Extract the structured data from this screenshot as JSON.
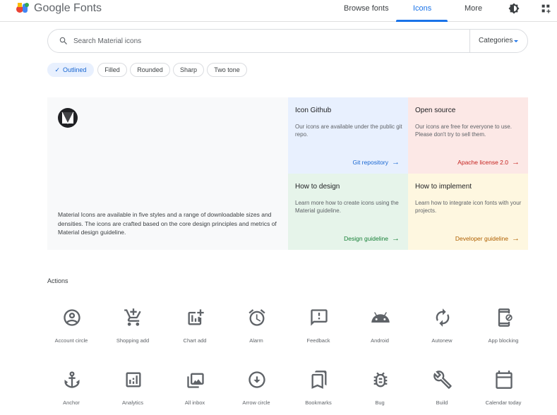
{
  "header": {
    "brand": "Google Fonts",
    "nav": {
      "browse": "Browse fonts",
      "icons": "Icons",
      "more": "More"
    },
    "logo_colors": [
      "#4285f4",
      "#ea4335",
      "#fbbc04",
      "#34a853"
    ],
    "active_color": "#1a73e8"
  },
  "search": {
    "placeholder": "Search Material icons",
    "categories_label": "Categories"
  },
  "styles": {
    "chips": [
      "Outlined",
      "Filled",
      "Rounded",
      "Sharp",
      "Two tone"
    ],
    "selected": "Outlined"
  },
  "intro": {
    "text": "Material Icons are available in five styles and a range of downloadable sizes and densities. The icons are crafted based on the core design principles and metrics of Material design guideline."
  },
  "cards": {
    "github": {
      "title": "Icon Github",
      "desc": "Our icons are available under the public git repo.",
      "link": "Git repository",
      "color": "#1967d2"
    },
    "open_source": {
      "title": "Open source",
      "desc": "Our icons are free for everyone to use. Please don't try to sell them.",
      "link": "Apache license 2.0",
      "color": "#c5221f"
    },
    "design": {
      "title": "How to design",
      "desc": "Learn more how to create icons using the Material guideline.",
      "link": "Design guideline",
      "color": "#188038"
    },
    "implement": {
      "title": "How to implement",
      "desc": "Learn how to integrate icon fonts with your projects.",
      "link": "Developer guideline",
      "color": "#b06000"
    }
  },
  "section": {
    "title": "Actions",
    "icons": [
      {
        "label": "Account circle",
        "icon": "account-circle-icon"
      },
      {
        "label": "Shopping add",
        "icon": "shopping-add-icon"
      },
      {
        "label": "Chart add",
        "icon": "chart-add-icon"
      },
      {
        "label": "Alarm",
        "icon": "alarm-icon"
      },
      {
        "label": "Feedback",
        "icon": "feedback-icon"
      },
      {
        "label": "Android",
        "icon": "android-icon"
      },
      {
        "label": "Autonew",
        "icon": "autonew-icon"
      },
      {
        "label": "App blocking",
        "icon": "app-blocking-icon"
      },
      {
        "label": "Anchor",
        "icon": "anchor-icon"
      },
      {
        "label": "Analytics",
        "icon": "analytics-icon"
      },
      {
        "label": "All inbox",
        "icon": "all-inbox-icon"
      },
      {
        "label": "Arrow circle",
        "icon": "arrow-circle-icon"
      },
      {
        "label": "Bookmarks",
        "icon": "bookmarks-icon"
      },
      {
        "label": "Bug",
        "icon": "bug-icon"
      },
      {
        "label": "Build",
        "icon": "build-icon"
      },
      {
        "label": "Calendar today",
        "icon": "calendar-today-icon"
      }
    ]
  }
}
